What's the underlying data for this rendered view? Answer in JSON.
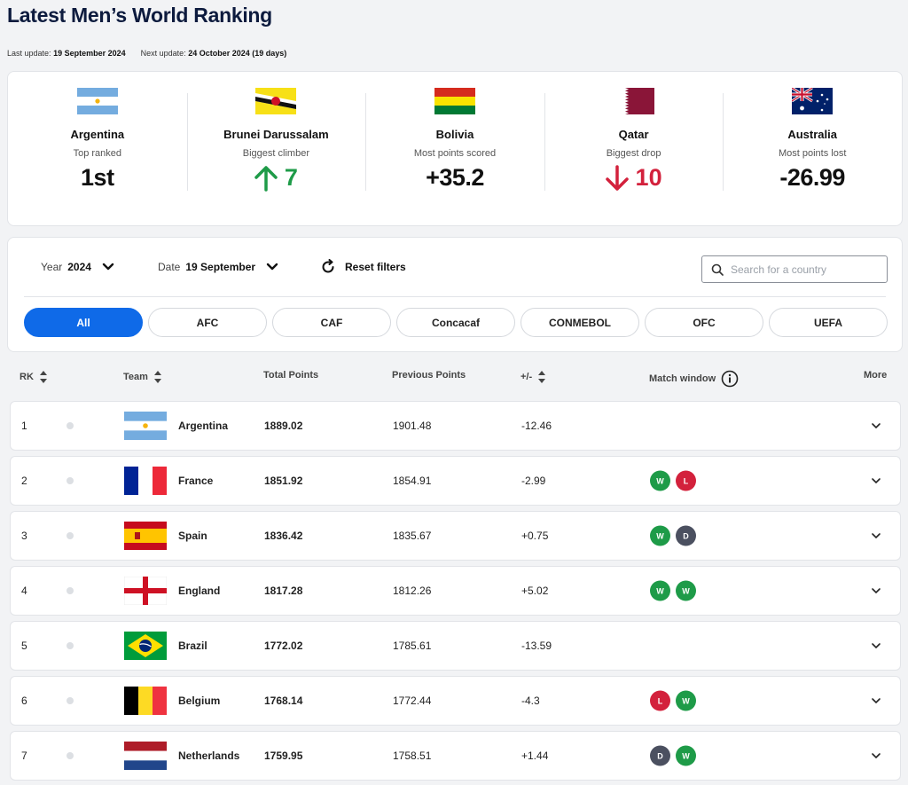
{
  "title": "Latest Men’s World Ranking",
  "updates": {
    "last_label": "Last update:",
    "last_value": "19 September 2024",
    "next_label": "Next update:",
    "next_value": "24 October 2024 (19 days)"
  },
  "highlights": [
    {
      "country": "Argentina",
      "caption": "Top ranked",
      "value": "1st",
      "flag": "argentina"
    },
    {
      "country": "Brunei Darussalam",
      "caption": "Biggest climber",
      "value": "7",
      "direction": "up",
      "flag": "brunei"
    },
    {
      "country": "Bolivia",
      "caption": "Most points scored",
      "value": "+35.2",
      "flag": "bolivia"
    },
    {
      "country": "Qatar",
      "caption": "Biggest drop",
      "value": "10",
      "direction": "down",
      "flag": "qatar"
    },
    {
      "country": "Australia",
      "caption": "Most points lost",
      "value": "-26.99",
      "flag": "australia"
    }
  ],
  "filters": {
    "year_label": "Year",
    "year_value": "2024",
    "date_label": "Date",
    "date_value": "19 September",
    "reset_label": "Reset filters",
    "search_placeholder": "Search for a country",
    "confederations": [
      "All",
      "AFC",
      "CAF",
      "Concacaf",
      "CONMEBOL",
      "OFC",
      "UEFA"
    ],
    "active_confederation": "All"
  },
  "table": {
    "headers": {
      "rank": "RK",
      "team": "Team",
      "total": "Total Points",
      "previous": "Previous Points",
      "diff": "+/-",
      "match": "Match window",
      "more": "More"
    },
    "rows": [
      {
        "rank": "1",
        "team": "Argentina",
        "total": "1889.02",
        "previous": "1901.48",
        "diff": "-12.46",
        "results": [],
        "flag": "argentina"
      },
      {
        "rank": "2",
        "team": "France",
        "total": "1851.92",
        "previous": "1854.91",
        "diff": "-2.99",
        "results": [
          "W",
          "L"
        ],
        "flag": "france"
      },
      {
        "rank": "3",
        "team": "Spain",
        "total": "1836.42",
        "previous": "1835.67",
        "diff": "+0.75",
        "results": [
          "W",
          "D"
        ],
        "flag": "spain"
      },
      {
        "rank": "4",
        "team": "England",
        "total": "1817.28",
        "previous": "1812.26",
        "diff": "+5.02",
        "results": [
          "W",
          "W"
        ],
        "flag": "england"
      },
      {
        "rank": "5",
        "team": "Brazil",
        "total": "1772.02",
        "previous": "1785.61",
        "diff": "-13.59",
        "results": [],
        "flag": "brazil"
      },
      {
        "rank": "6",
        "team": "Belgium",
        "total": "1768.14",
        "previous": "1772.44",
        "diff": "-4.3",
        "results": [
          "L",
          "W"
        ],
        "flag": "belgium"
      },
      {
        "rank": "7",
        "team": "Netherlands",
        "total": "1759.95",
        "previous": "1758.51",
        "diff": "+1.44",
        "results": [
          "D",
          "W"
        ],
        "flag": "netherlands"
      }
    ]
  },
  "colors": {
    "accent": "#0f6ae8",
    "win": "#1e9b48",
    "loss": "#d3213c",
    "draw": "#4b5060",
    "title": "#0d1b3e"
  }
}
